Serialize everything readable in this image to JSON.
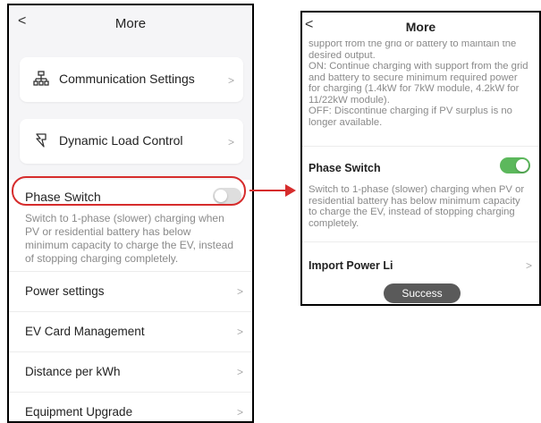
{
  "left": {
    "header": {
      "back": "<",
      "title": "More"
    },
    "cards": [
      {
        "label": "Communication Settings",
        "icon": "network-icon"
      },
      {
        "label": "Dynamic Load Control",
        "icon": "load-control-icon"
      }
    ],
    "phase_switch": {
      "label": "Phase Switch",
      "description": "Switch to 1-phase (slower) charging when PV or residential battery has below minimum capacity to charge the EV, instead of stopping charging completely.",
      "enabled": false
    },
    "rows": [
      {
        "label": "Power settings"
      },
      {
        "label": "EV Card Management"
      },
      {
        "label": "Distance per kWh"
      },
      {
        "label": "Equipment Upgrade"
      }
    ],
    "chevron": ">"
  },
  "right": {
    "header": {
      "back": "<",
      "title": "More"
    },
    "top_text": "support from the grid or battery to maintain the desired output.\nON: Continue charging with support from the grid and battery to secure minimum required power for charging (1.4kW for 7kW module, 4.2kW for 11/22kW module).\nOFF:  Discontinue charging if PV surplus is no longer available.",
    "phase_switch": {
      "label": "Phase Switch",
      "description": "Switch to 1-phase (slower) charging when PV or residential battery has below minimum capacity to charge the EV, instead of stopping charging completely.",
      "enabled": true
    },
    "import_power": "Import Power Li",
    "chevron": ">",
    "toast": "Success"
  },
  "colors": {
    "toggle_on": "#5cb85c",
    "toggle_off": "#dedede",
    "callout": "#d62c2c"
  }
}
